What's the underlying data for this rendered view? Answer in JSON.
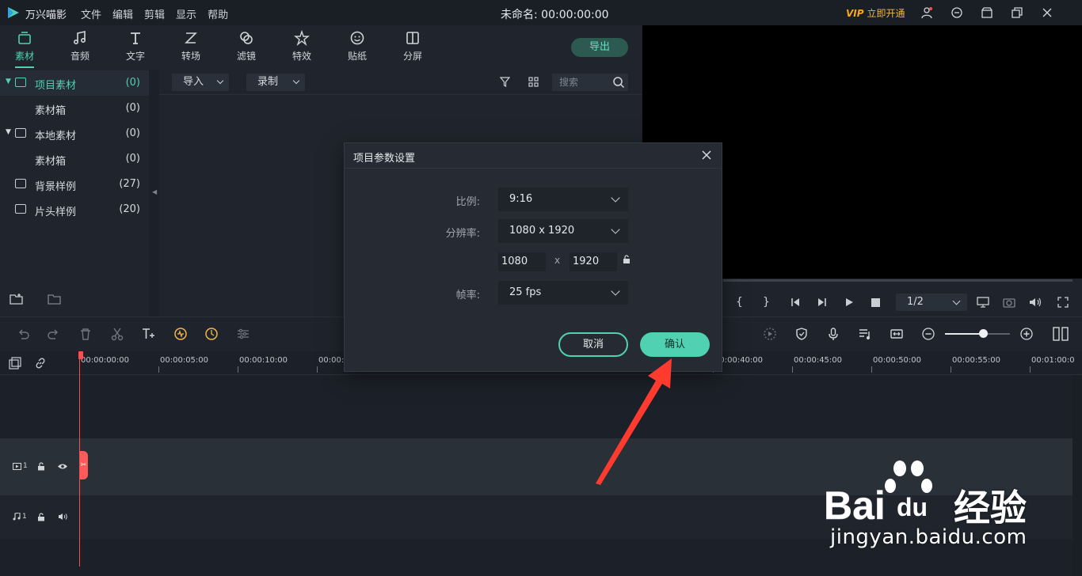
{
  "titlebar": {
    "app_name": "万兴喵影",
    "menu": [
      "文件",
      "编辑",
      "剪辑",
      "显示",
      "帮助"
    ],
    "doc_title": "未命名: 00:00:00:00",
    "vip_badge": "VIP",
    "vip_text": "立即开通"
  },
  "toolbar": {
    "tabs": [
      {
        "label": "素材",
        "icon": "media-icon"
      },
      {
        "label": "音频",
        "icon": "music-icon"
      },
      {
        "label": "文字",
        "icon": "text-icon"
      },
      {
        "label": "转场",
        "icon": "transition-icon"
      },
      {
        "label": "滤镜",
        "icon": "filter-icon"
      },
      {
        "label": "特效",
        "icon": "effects-icon"
      },
      {
        "label": "贴纸",
        "icon": "sticker-icon"
      },
      {
        "label": "分屏",
        "icon": "splitscreen-icon"
      }
    ],
    "export_label": "导出"
  },
  "library": {
    "items": [
      {
        "label": "项目素材",
        "count": "(0)"
      },
      {
        "label": "素材箱",
        "count": "(0)"
      },
      {
        "label": "本地素材",
        "count": "(0)"
      },
      {
        "label": "素材箱",
        "count": "(0)"
      },
      {
        "label": "背景样例",
        "count": "(27)"
      },
      {
        "label": "片头样例",
        "count": "(20)"
      }
    ]
  },
  "media": {
    "import_label": "导入",
    "record_label": "录制",
    "search_placeholder": "搜索"
  },
  "preview": {
    "page_indicator": "1/2",
    "mark_in": "{",
    "mark_out": "}"
  },
  "timeline": {
    "ruler_labels": [
      "00:00:00:00",
      "00:00:05:00",
      "00:00:10:00",
      "00:00:",
      "00:00:40:00",
      "00:00:45:00",
      "00:00:50:00",
      "00:00:55:00",
      "00:01:00:0"
    ],
    "video_track": "1",
    "audio_track": "1"
  },
  "dialog": {
    "title": "项目参数设置",
    "ratio_label": "比例:",
    "ratio_value": "9:16",
    "resolution_label": "分辨率:",
    "resolution_value": "1080 x 1920",
    "width_value": "1080",
    "x_sign": "x",
    "height_value": "1920",
    "fps_label": "帧率:",
    "fps_value": "25 fps",
    "cancel_label": "取消",
    "ok_label": "确认"
  },
  "watermark": {
    "brand": "Bai",
    "brand2": "du",
    "cn": "经验",
    "url": "jingyan.baidu.com"
  },
  "colors": {
    "accent": "#4fd1b2",
    "playhead": "#ff4d4d",
    "annotation": "#ff3b2f",
    "vip": "#f5a623"
  }
}
